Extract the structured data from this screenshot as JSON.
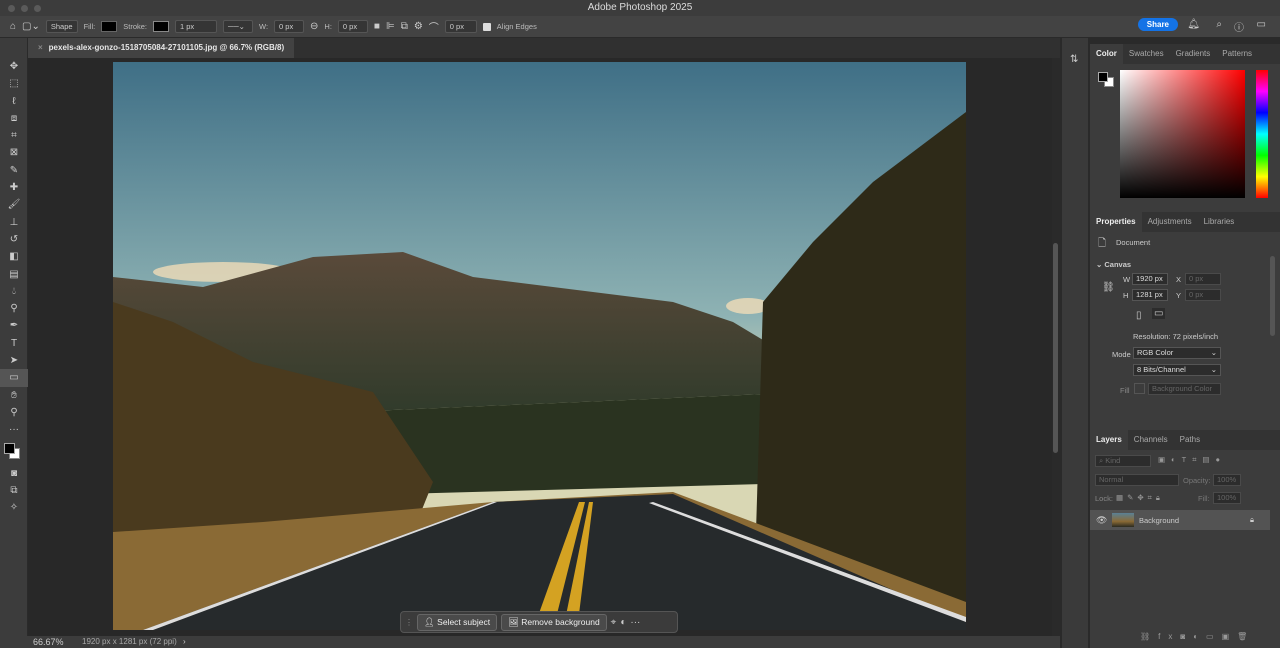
{
  "app": {
    "title": "Adobe Photoshop 2025"
  },
  "options": {
    "shape_mode": "Shape",
    "fill_label": "Fill:",
    "stroke_label": "Stroke:",
    "stroke_width": "1 px",
    "w_label": "W:",
    "w_value": "0 px",
    "h_label": "H:",
    "h_value": "0 px",
    "radius": "0 px",
    "align_edges": "Align Edges",
    "share": "Share"
  },
  "document": {
    "tab_title": "pexels-alex-gonzo-1518705084-27101105.jpg @ 66.7% (RGB/8)"
  },
  "status": {
    "zoom": "66.67%",
    "info": "1920 px x 1281 px (72 ppi)"
  },
  "contextbar": {
    "select_subject": "Select subject",
    "remove_background": "Remove background"
  },
  "color_panel": {
    "tabs": [
      "Color",
      "Swatches",
      "Gradients",
      "Patterns"
    ]
  },
  "properties": {
    "tabs": [
      "Properties",
      "Adjustments",
      "Libraries"
    ],
    "type": "Document",
    "section": "Canvas",
    "w_label": "W",
    "w": "1920 px",
    "h_label": "H",
    "h": "1281 px",
    "x_label": "X",
    "x": "0 px",
    "y_label": "Y",
    "y": "0 px",
    "resolution": "Resolution: 72 pixels/inch",
    "mode_label": "Mode",
    "mode": "RGB Color",
    "bits": "8 Bits/Channel",
    "fill_label": "Fill",
    "fill": "Background Color"
  },
  "layers": {
    "tabs": [
      "Layers",
      "Channels",
      "Paths"
    ],
    "kind": "Kind",
    "blend": "Normal",
    "opacity_label": "Opacity:",
    "opacity": "100%",
    "lock_label": "Lock:",
    "fill_label": "Fill:",
    "fill": "100%",
    "items": [
      {
        "name": "Background"
      }
    ]
  },
  "colors": {
    "accent": "#1473e6"
  }
}
